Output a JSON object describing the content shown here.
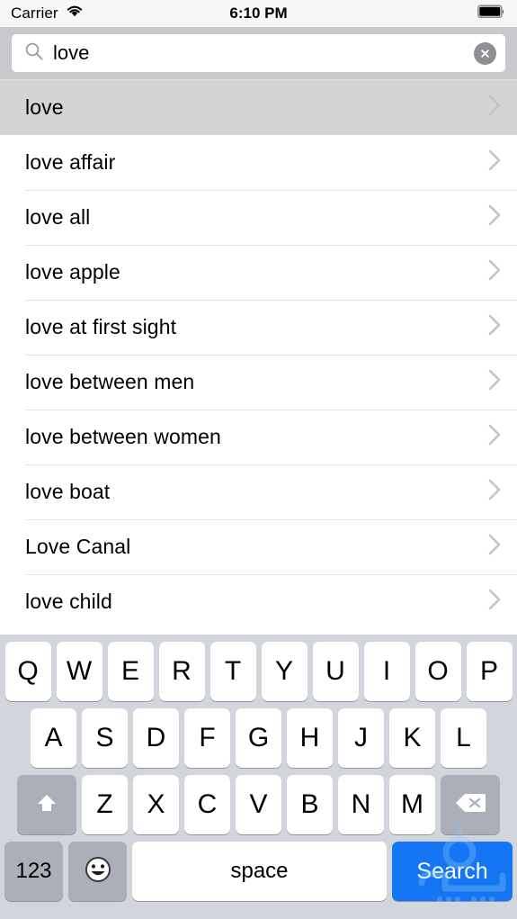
{
  "status_bar": {
    "carrier": "Carrier",
    "wifi_icon": "wifi-icon",
    "time": "6:10 PM",
    "battery_icon": "battery-full-icon"
  },
  "search": {
    "icon": "search-icon",
    "value": "love",
    "placeholder": "Search",
    "clear_icon": "clear-circle-icon"
  },
  "suggestions": [
    {
      "label": "love",
      "selected": true,
      "accessory": "chevron-right-icon"
    },
    {
      "label": "love affair",
      "selected": false,
      "accessory": "chevron-right-icon"
    },
    {
      "label": "love all",
      "selected": false,
      "accessory": "chevron-right-icon"
    },
    {
      "label": "love apple",
      "selected": false,
      "accessory": "chevron-right-icon"
    },
    {
      "label": "love at first sight",
      "selected": false,
      "accessory": "chevron-right-icon"
    },
    {
      "label": "love between men",
      "selected": false,
      "accessory": "chevron-right-icon"
    },
    {
      "label": "love between women",
      "selected": false,
      "accessory": "chevron-right-icon"
    },
    {
      "label": "love boat",
      "selected": false,
      "accessory": "chevron-right-icon"
    },
    {
      "label": "Love Canal",
      "selected": false,
      "accessory": "chevron-right-icon"
    },
    {
      "label": "love child",
      "selected": false,
      "accessory": "chevron-right-icon"
    }
  ],
  "keyboard": {
    "row1": [
      "Q",
      "W",
      "E",
      "R",
      "T",
      "Y",
      "U",
      "I",
      "O",
      "P"
    ],
    "row2": [
      "A",
      "S",
      "D",
      "F",
      "G",
      "H",
      "J",
      "K",
      "L"
    ],
    "row3": [
      "Z",
      "X",
      "C",
      "V",
      "B",
      "N",
      "M"
    ],
    "shift_icon": "shift-arrow-icon",
    "backspace_icon": "backspace-icon",
    "numeric_label": "123",
    "emoji_icon": "emoji-smiley-icon",
    "space_label": "space",
    "search_label": "Search"
  },
  "colors": {
    "accent": "#1476f4",
    "keyboard_bg": "#d2d5db",
    "searchbar_bg": "#c8c8cd",
    "row_selected": "#d4d4d4"
  },
  "watermark": {
    "name": "site-logo-watermark"
  }
}
